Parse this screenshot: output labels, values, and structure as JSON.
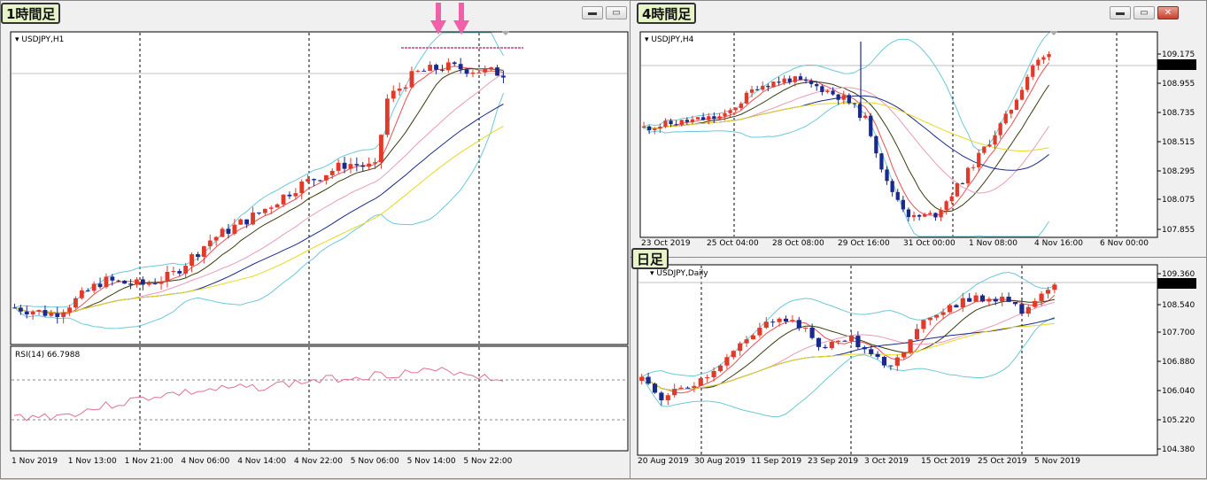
{
  "colors": {
    "bull": "#e03a2a",
    "bear": "#1a2a8c",
    "rsi": "#e07090",
    "bb": "#6cc8d8",
    "ma_red": "#e85050",
    "ma_pink": "#e89ab8",
    "ma_dark": "#3a3a10",
    "ma_navy": "#1a2a8c",
    "ma_yellow": "#e8d820",
    "marker": "#f060a8"
  },
  "icons": {
    "minimize": "minimize-icon",
    "maximize": "maximize-icon",
    "close": "close-icon",
    "dropdown": "triangle-down-icon",
    "arrow": "arrow-down-icon"
  },
  "windows": {
    "h1": {
      "tag": "1時間足",
      "symbol": "USDJPY,H1",
      "rsi_label": "RSI(14) 66.7988",
      "xticks": [
        "1 Nov 2019",
        "1 Nov 13:00",
        "1 Nov 21:00",
        "4 Nov 06:00",
        "4 Nov 14:00",
        "4 Nov 22:00",
        "5 Nov 06:00",
        "5 Nov 14:00",
        "5 Nov 22:00"
      ],
      "buttons": {
        "minimize": "▬",
        "maximize": "▭"
      }
    },
    "h4": {
      "tag": "4時間足",
      "symbol": "USDJPY,H4",
      "price_tag": "109.116",
      "yticks": [
        "109.175",
        "108.955",
        "108.735",
        "108.515",
        "108.295",
        "108.075",
        "107.855"
      ],
      "xticks": [
        "23 Oct 2019",
        "25 Oct 04:00",
        "28 Oct 08:00",
        "29 Oct 16:00",
        "31 Oct 00:00",
        "1 Nov 08:00",
        "4 Nov 16:00",
        "6 Nov 00:00"
      ],
      "buttons": {
        "minimize": "▬",
        "maximize": "▭",
        "close": "✕"
      }
    },
    "d1": {
      "tag": "日足",
      "symbol": "USDJPY,Daily",
      "price_tag": "109.116",
      "yticks": [
        "109.360",
        "108.540",
        "107.700",
        "106.880",
        "106.040",
        "105.220",
        "104.380"
      ],
      "xticks": [
        "20 Aug 2019",
        "30 Aug 2019",
        "11 Sep 2019",
        "23 Sep 2019",
        "3 Oct 2019",
        "15 Oct 2019",
        "25 Oct 2019",
        "5 Nov 2019"
      ]
    }
  }
}
